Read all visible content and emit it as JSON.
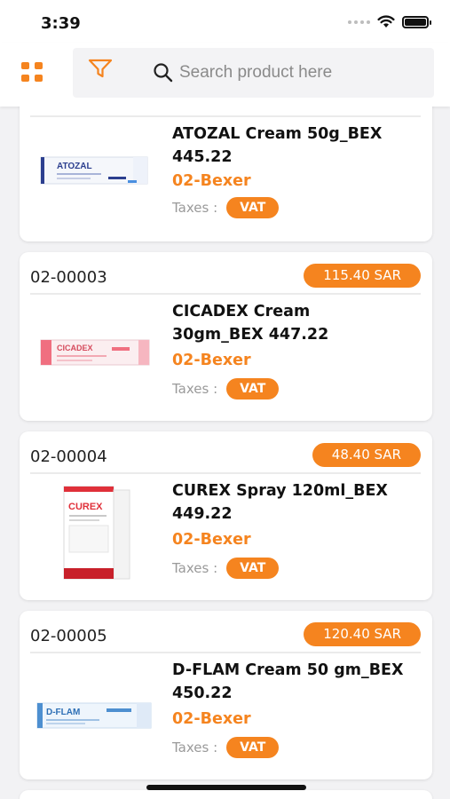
{
  "status_bar": {
    "time": "3:39"
  },
  "header": {
    "search": {
      "placeholder": "Search product here",
      "value": ""
    }
  },
  "products": [
    {
      "code": "",
      "price": "",
      "name_line1": "ATOZAL Cream 50g_BEX",
      "name_line2": "445.22",
      "brand": "02-Bexer",
      "taxes_label": "Taxes :",
      "tax": "VAT",
      "image_label": "ATOZAL"
    },
    {
      "code": "02-00003",
      "price": "115.40 SAR",
      "name_line1": "CICADEX Cream",
      "name_line2": "30gm_BEX 447.22",
      "brand": "02-Bexer",
      "taxes_label": "Taxes :",
      "tax": "VAT",
      "image_label": "CICADEX"
    },
    {
      "code": "02-00004",
      "price": "48.40 SAR",
      "name_line1": "CUREX Spray 120ml_BEX",
      "name_line2": "449.22",
      "brand": "02-Bexer",
      "taxes_label": "Taxes :",
      "tax": "VAT",
      "image_label": "CUREX"
    },
    {
      "code": "02-00005",
      "price": "120.40 SAR",
      "name_line1": "D-FLAM Cream 50 gm_BEX",
      "name_line2": "450.22",
      "brand": "02-Bexer",
      "taxes_label": "Taxes :",
      "tax": "VAT",
      "image_label": "D-FLAM"
    }
  ],
  "colors": {
    "accent": "#f5841f",
    "background": "#f2f2f4",
    "card": "#ffffff"
  },
  "icons": [
    "wifi-icon",
    "battery-icon",
    "grid-menu-icon",
    "filter-icon",
    "search-icon"
  ]
}
